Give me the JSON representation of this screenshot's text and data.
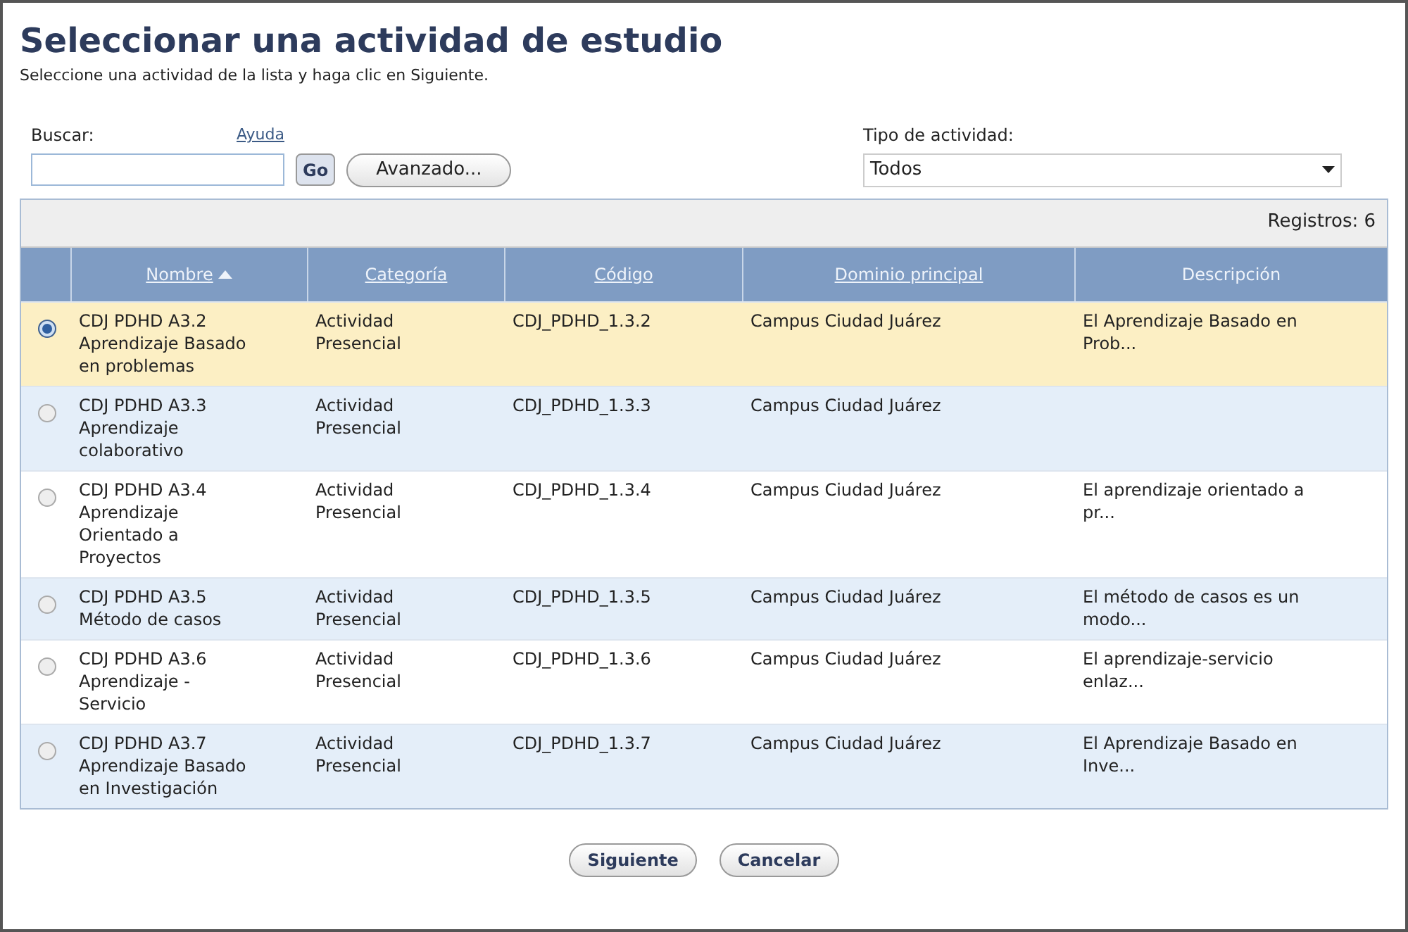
{
  "title": "Seleccionar una actividad de estudio",
  "subtitle": "Seleccione una actividad de la lista y haga clic en Siguiente.",
  "search": {
    "label": "Buscar:",
    "help_link": "Ayuda",
    "go_button": "Go",
    "advanced_button": "Avanzado..."
  },
  "activity_type": {
    "label": "Tipo de actividad:",
    "value": "Todos"
  },
  "records": "Registros: 6",
  "table": {
    "columns": [
      {
        "label": "Nombre",
        "link": true,
        "sorted": true
      },
      {
        "label": "Categoría",
        "link": true,
        "sorted": false
      },
      {
        "label": "Código",
        "link": true,
        "sorted": false
      },
      {
        "label": "Dominio principal",
        "link": true,
        "sorted": false
      },
      {
        "label": "Descripción",
        "link": false,
        "sorted": false
      }
    ],
    "rows": [
      {
        "selected": true,
        "cells": [
          "CDJ PDHD A3.2\nAprendizaje Basado\nen problemas",
          "Actividad\nPresencial",
          "CDJ_PDHD_1.3.2",
          "Campus Ciudad Juárez",
          "El Aprendizaje Basado en\nProb..."
        ]
      },
      {
        "selected": false,
        "cells": [
          "CDJ PDHD A3.3\nAprendizaje\ncolaborativo",
          "Actividad\nPresencial",
          "CDJ_PDHD_1.3.3",
          "Campus Ciudad Juárez",
          ""
        ]
      },
      {
        "selected": false,
        "cells": [
          "CDJ PDHD A3.4\nAprendizaje\nOrientado a\nProyectos",
          "Actividad\nPresencial",
          "CDJ_PDHD_1.3.4",
          "Campus Ciudad Juárez",
          "El aprendizaje orientado a\npr..."
        ]
      },
      {
        "selected": false,
        "cells": [
          "CDJ PDHD A3.5\nMétodo de casos",
          "Actividad\nPresencial",
          "CDJ_PDHD_1.3.5",
          "Campus Ciudad Juárez",
          "El método de casos es un\nmodo..."
        ]
      },
      {
        "selected": false,
        "cells": [
          "CDJ PDHD A3.6\nAprendizaje -\nServicio",
          "Actividad\nPresencial",
          "CDJ_PDHD_1.3.6",
          "Campus Ciudad Juárez",
          "El aprendizaje-servicio\nenlaz..."
        ]
      },
      {
        "selected": false,
        "cells": [
          "CDJ PDHD A3.7\nAprendizaje Basado\nen Investigación",
          "Actividad\nPresencial",
          "CDJ_PDHD_1.3.7",
          "Campus Ciudad Juárez",
          "El Aprendizaje Basado en\nInve..."
        ]
      }
    ]
  },
  "buttons": [
    "Siguiente",
    "Cancelar"
  ]
}
